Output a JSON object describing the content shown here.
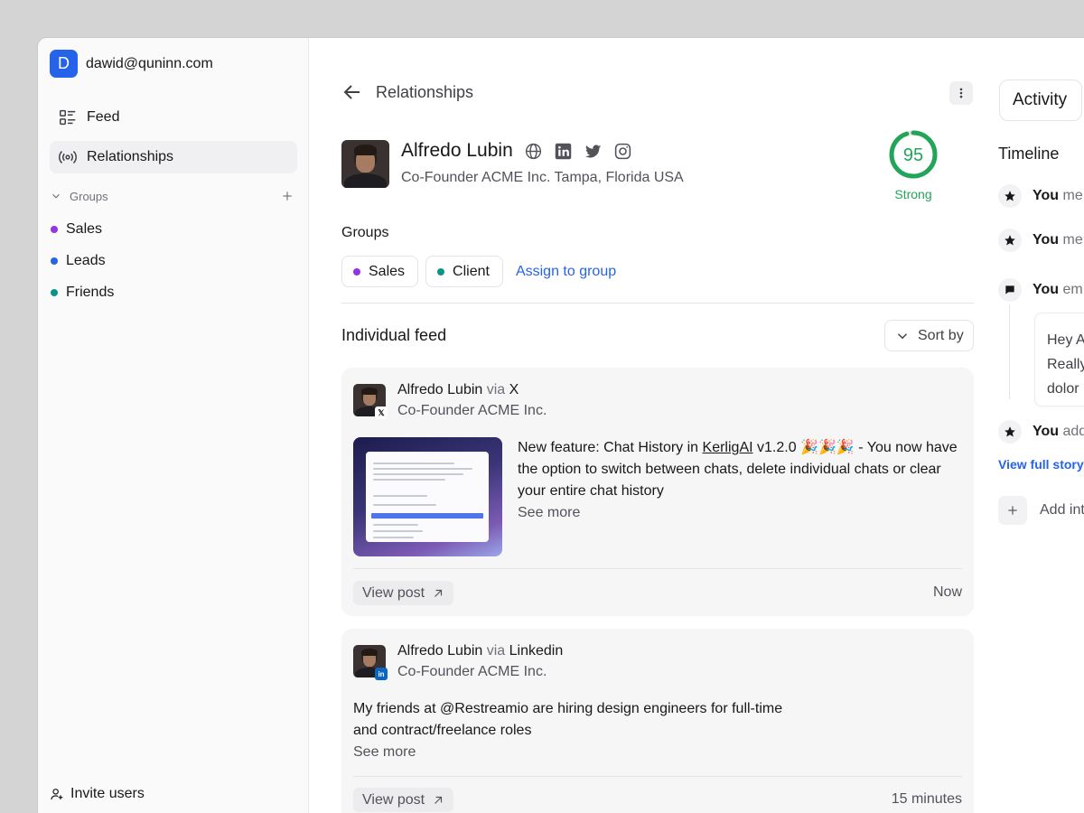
{
  "account": {
    "initial": "D",
    "email": "dawid@quninn.com"
  },
  "nav": {
    "feed": "Feed",
    "relationships": "Relationships"
  },
  "groups": {
    "label": "Groups",
    "items": [
      {
        "label": "Sales",
        "color": "#9333ea"
      },
      {
        "label": "Leads",
        "color": "#2563eb"
      },
      {
        "label": "Friends",
        "color": "#0d9488"
      }
    ]
  },
  "invite_label": "Invite users",
  "header": {
    "back_title": "Relationships"
  },
  "profile": {
    "name": "Alfredo Lubin",
    "subtitle": "Co-Founder ACME Inc. Tampa, Florida USA",
    "score": "95",
    "score_fraction": 0.95,
    "score_label": "Strong",
    "score_color": "#22a559"
  },
  "profile_groups": {
    "label": "Groups",
    "chips": [
      {
        "label": "Sales",
        "color": "#9333ea"
      },
      {
        "label": "Client",
        "color": "#0d9488"
      }
    ],
    "assign_label": "Assign to group"
  },
  "feed": {
    "title": "Individual feed",
    "sort_label": "Sort by",
    "posts": [
      {
        "author": "Alfredo Lubin",
        "via": "via",
        "source": "X",
        "role": "Co-Founder ACME Inc.",
        "text_pre": "New feature: Chat History in ",
        "text_link": "KerligAI",
        "text_mid": " v1.2.0 🎉🎉🎉 - You now have the option to switch between chats, delete individual chats or clear your entire chat history",
        "see_more": "See more",
        "view_post": "View post",
        "time": "Now"
      },
      {
        "author": "Alfredo Lubin",
        "via": "via",
        "source": "Linkedin",
        "role": "Co-Founder ACME Inc.",
        "text_line1": "My friends at @Restreamio are hiring design engineers for full-time",
        "text_line2": "and contract/freelance roles",
        "see_more": "See more",
        "view_post": "View post",
        "time": "15 minutes"
      }
    ]
  },
  "activity": {
    "tab_label": "Activity",
    "timeline_title": "Timeline",
    "items": [
      {
        "who": "You",
        "rest": "me",
        "icon": "star-icon"
      },
      {
        "who": "You",
        "rest": "me",
        "icon": "star-icon"
      },
      {
        "who": "You",
        "rest": "em",
        "icon": "message-icon"
      },
      {
        "who": "You",
        "rest": "add",
        "icon": "star-icon"
      }
    ],
    "message_lines": [
      "Hey A",
      "Really",
      "dolor"
    ],
    "view_full": "View full story",
    "add_label": "Add int"
  }
}
